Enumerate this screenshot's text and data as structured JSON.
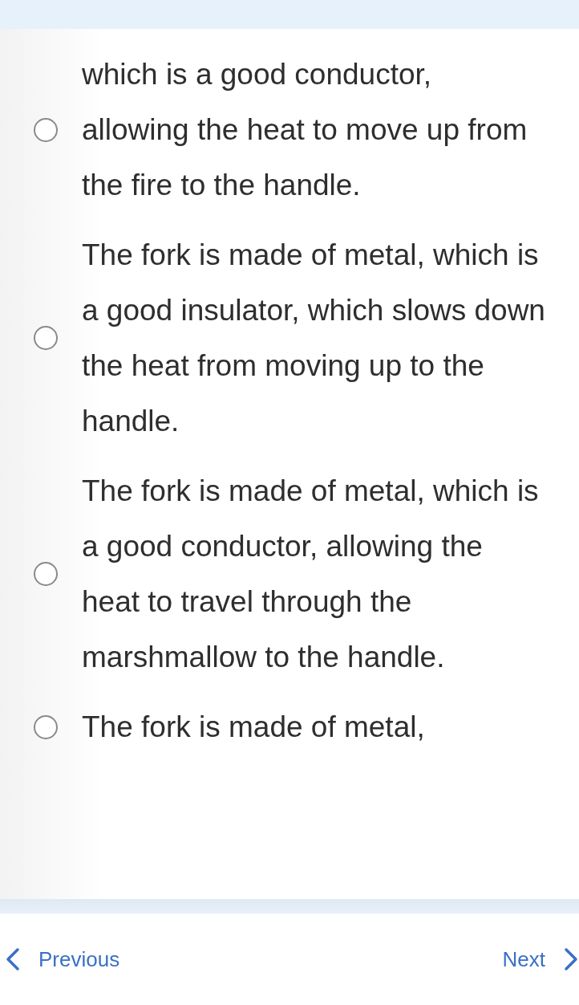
{
  "options": [
    {
      "text": "which is a good conductor, allowing the heat to move up from the fire to the handle.",
      "selected": false
    },
    {
      "text": "The fork is made of metal, which is a good insulator, which slows down the heat from moving up to the handle.",
      "selected": false
    },
    {
      "text": "The fork is made of metal, which is a good conductor, allowing the heat to travel through the marshmallow to the handle.",
      "selected": false
    },
    {
      "text": "The fork is made of metal,",
      "selected": false
    }
  ],
  "navigation": {
    "previous": "Previous",
    "next": "Next"
  }
}
